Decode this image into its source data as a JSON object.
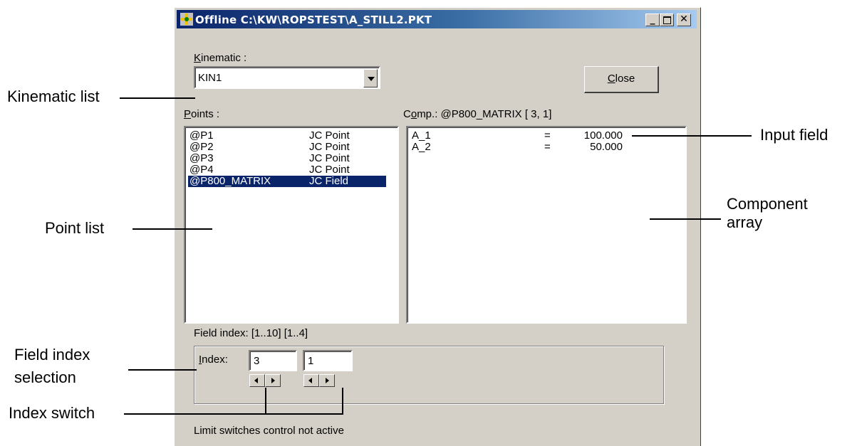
{
  "window": {
    "title": "Offline C:\\KW\\ROPSTEST\\A_STILL2.PKT",
    "minimize_icon": "minimize-icon",
    "maximize_icon": "maximize-icon",
    "close_icon": "close-icon"
  },
  "kinematic": {
    "label_underlined": "K",
    "label_rest": "inematic :",
    "value": "KIN1"
  },
  "close_button": {
    "underlined": "C",
    "rest": "lose"
  },
  "points": {
    "label_underlined": "P",
    "label_rest": "oints :",
    "items": [
      {
        "name": "@P1",
        "type": "JC Point",
        "selected": false
      },
      {
        "name": "@P2",
        "type": "JC Point",
        "selected": false
      },
      {
        "name": "@P3",
        "type": "JC Point",
        "selected": false
      },
      {
        "name": "@P4",
        "type": "JC Point",
        "selected": false
      },
      {
        "name": "@P800_MATRIX",
        "type": "JC Field",
        "selected": true
      }
    ]
  },
  "components": {
    "label_first": "C",
    "label_underlined": "o",
    "label_rest": "mp.: @P800_MATRIX [ 3, 1]",
    "items": [
      {
        "name": "A_1",
        "eq": "=",
        "value": "100.000"
      },
      {
        "name": "A_2",
        "eq": "=",
        "value": "50.000"
      }
    ]
  },
  "field_index": {
    "label": "Field index: [1..10] [1..4]",
    "index_label_underlined": "I",
    "index_label_rest": "ndex:",
    "index1": "3",
    "index2": "1"
  },
  "status": "Limit switches control not active",
  "callouts": {
    "kinematic_list": "Kinematic list",
    "input_field": "Input field",
    "point_list": "Point list",
    "component_array_1": "Component",
    "component_array_2": "array",
    "field_index_1": "Field index",
    "field_index_2": "selection",
    "index_switch": "Index switch"
  }
}
